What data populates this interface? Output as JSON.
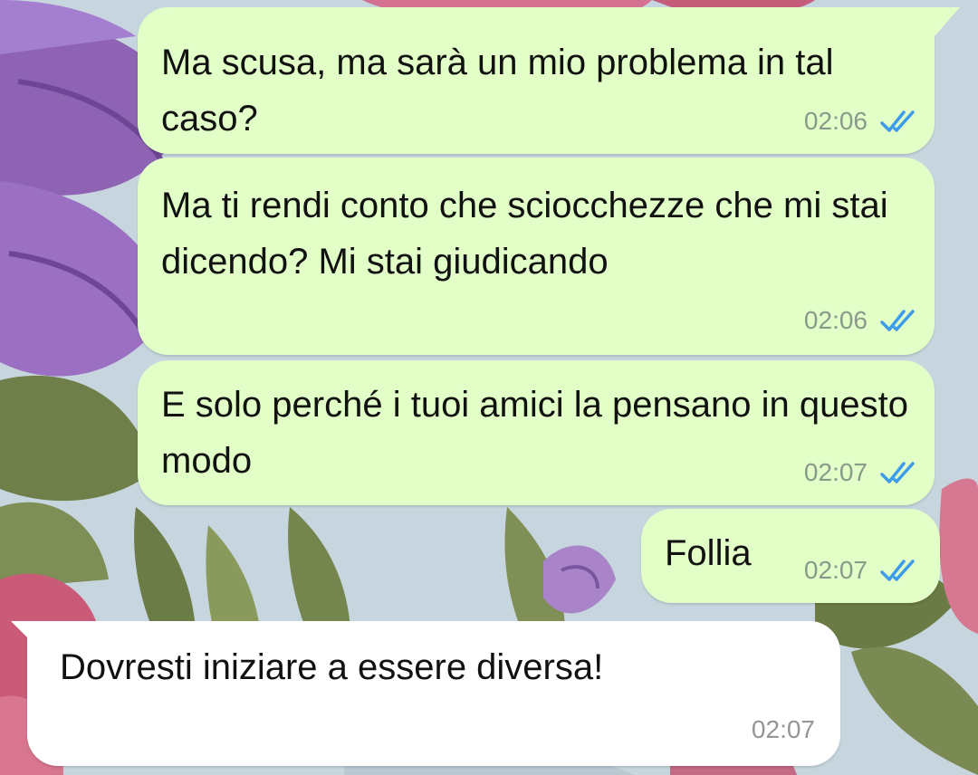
{
  "chat": {
    "messages": [
      {
        "direction": "outgoing",
        "text": "Ma scusa, ma sarà un mio problema in tal caso?",
        "time": "02:06",
        "status_icon": "double-check-read-icon"
      },
      {
        "direction": "outgoing",
        "text": "Ma ti rendi conto che sciocchezze che mi stai dicendo? Mi stai giudicando",
        "time": "02:06",
        "status_icon": "double-check-read-icon"
      },
      {
        "direction": "outgoing",
        "text": "E solo perché i tuoi amici la pensano in questo modo",
        "time": "02:07",
        "status_icon": "double-check-read-icon"
      },
      {
        "direction": "outgoing",
        "text": "Follia",
        "time": "02:07",
        "status_icon": "double-check-read-icon"
      },
      {
        "direction": "incoming",
        "text": "Dovresti iniziare a essere diversa!",
        "time": "02:07"
      }
    ]
  },
  "colors": {
    "outgoing_bubble": "#e2ffc7",
    "incoming_bubble": "#ffffff",
    "read_tick": "#3c9bea",
    "wallpaper_base": "#c7d6de"
  }
}
